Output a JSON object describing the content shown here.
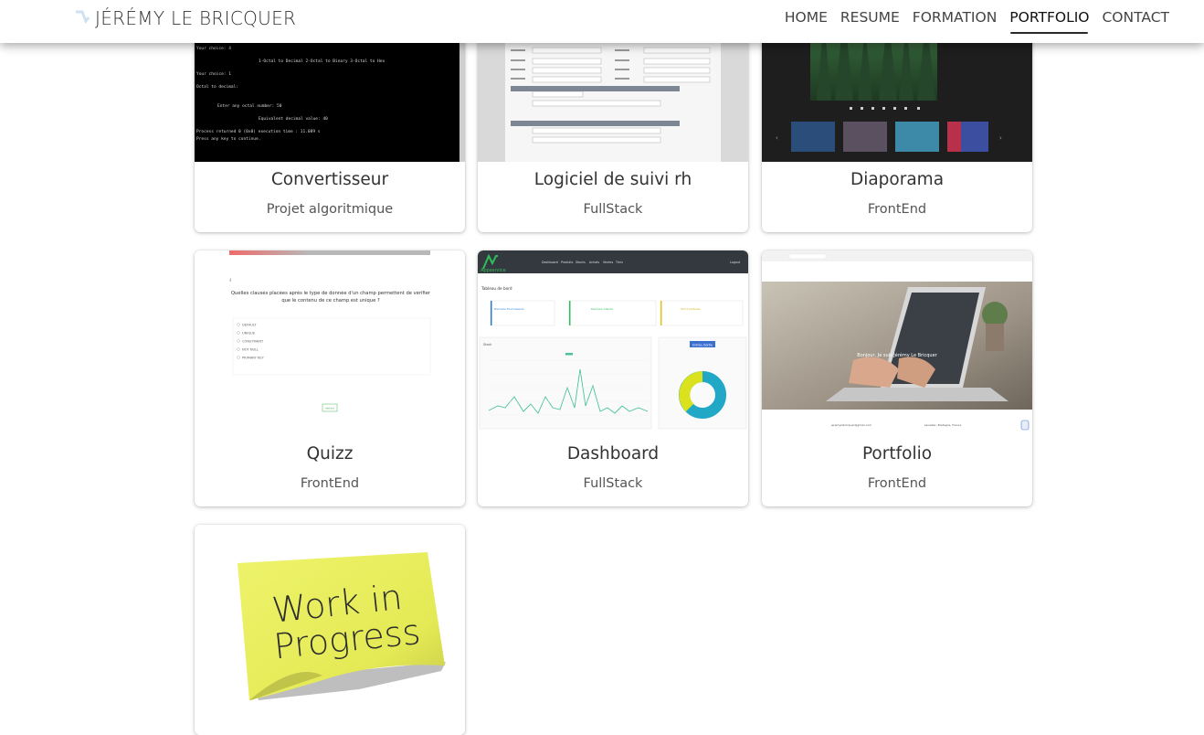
{
  "brand": {
    "name": "JÉRÉMY LE BRICQUER"
  },
  "nav": {
    "items": [
      "HOME",
      "RESUME",
      "FORMATION",
      "PORTFOLIO",
      "CONTACT"
    ],
    "active": "PORTFOLIO"
  },
  "projects": [
    {
      "title": "Convertisseur",
      "category": "Projet algoritmique",
      "image": "terminal-screenshot"
    },
    {
      "title": "Logiciel de suivi rh",
      "category": "FullStack",
      "image": "form-screenshot"
    },
    {
      "title": "Diaporama",
      "category": "FrontEnd",
      "image": "forest-slideshow-screenshot"
    },
    {
      "title": "Quizz",
      "category": "FrontEnd",
      "image": "quiz-screenshot"
    },
    {
      "title": "Dashboard",
      "category": "FullStack",
      "image": "dashboard-screenshot"
    },
    {
      "title": "Portfolio",
      "category": "FrontEnd",
      "image": "laptop-portfolio-screenshot"
    },
    {
      "title": "",
      "category": "",
      "image": "work-in-progress-sticky-note"
    }
  ],
  "thumb_text": {
    "terminal": {
      "choice1": "Your choice: 4",
      "menu": "1-Octal to Decimal      2-Octal to Binary      3-Octal to Hex",
      "choice2": "Your choice: 1",
      "heading": "Octal to decimal:",
      "prompt": "Enter any octal number: 50",
      "result": "Equivalent decimal value: 40",
      "process": "Process returned 0 (0x0)   execution time : 11.089 s",
      "press": "Press any key to continue."
    },
    "quiz": {
      "question": "Quelles clauses placées après le type de donnée d'un champ permettent de vérifier que le contenu de ce champ est unique ?",
      "options": [
        "DEFAULT",
        "UNIQUE",
        "CONSTRAINT",
        "NOT NULL",
        "PRIMARY KEY"
      ],
      "button": "Valider"
    },
    "dashboard": {
      "logo": "Appservice",
      "nav": [
        "Dashboard",
        "Produits",
        "Stocks",
        "Achats",
        "Ventes",
        "Tiers"
      ],
      "logout": "Logout",
      "page_title": "Tableau de bord",
      "cards": [
        "Derniers Fournisseurs",
        "Derniers Clients",
        "Stock partielle"
      ],
      "stock_label": "Stock",
      "chart_tag": "Entrée /Sortie"
    },
    "portfolio": {
      "caption": "Bonjour, Je suis Jérémy Le Bricquer",
      "email": "jeremylebricquer@gmail.com",
      "location": "Lanester, Bretagne, France"
    },
    "wip": {
      "line1": "Work in",
      "line2": "Progress"
    }
  },
  "colors": {
    "navbar_bg": "#ffffff",
    "nav_text": "#444444",
    "card_bg": "#ffffff",
    "sticky_note": "#e8ee63",
    "dashboard_green": "#2fbf57",
    "donut_teal": "#20a8c6",
    "donut_yellow": "#d9e21c"
  }
}
